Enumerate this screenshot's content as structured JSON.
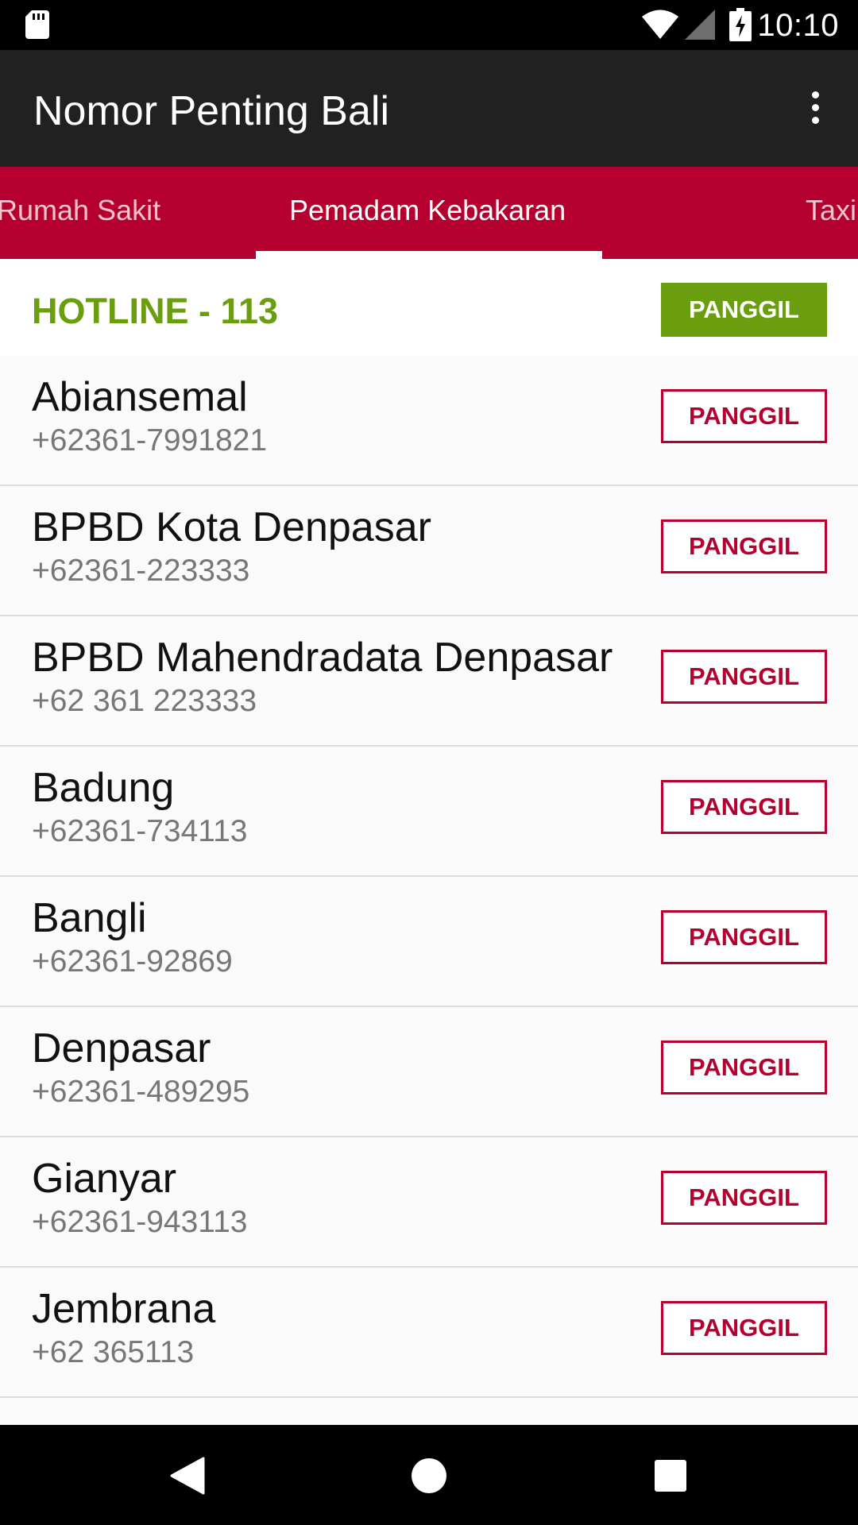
{
  "status_bar": {
    "time": "10:10",
    "icons": [
      "sd-card-icon",
      "wifi-icon",
      "signal-icon",
      "battery-charging-icon"
    ]
  },
  "app_bar": {
    "title": "Nomor Penting Bali",
    "menu_icon": "more-vert-icon"
  },
  "tabs": [
    {
      "label": "Rumah Sakit",
      "active": false
    },
    {
      "label": "Pemadam Kebakaran",
      "active": true
    },
    {
      "label": "Taxi",
      "active": false
    }
  ],
  "hotline": {
    "label": "HOTLINE - 113",
    "button_label": "PANGGIL"
  },
  "contacts": [
    {
      "name": "Abiansemal",
      "phone": "+62361-7991821",
      "button_label": "PANGGIL"
    },
    {
      "name": "BPBD Kota Denpasar",
      "phone": "+62361-223333",
      "button_label": "PANGGIL"
    },
    {
      "name": "BPBD Mahendradata Denpasar",
      "phone": "+62 361 223333",
      "button_label": "PANGGIL"
    },
    {
      "name": "Badung",
      "phone": "+62361-734113",
      "button_label": "PANGGIL"
    },
    {
      "name": "Bangli",
      "phone": "+62361-92869",
      "button_label": "PANGGIL"
    },
    {
      "name": "Denpasar",
      "phone": "+62361-489295",
      "button_label": "PANGGIL"
    },
    {
      "name": "Gianyar",
      "phone": "+62361-943113",
      "button_label": "PANGGIL"
    },
    {
      "name": "Jembrana",
      "phone": "+62 365113",
      "button_label": "PANGGIL"
    }
  ],
  "nav_bar": {
    "icons": [
      "back-icon",
      "home-icon",
      "recents-icon"
    ]
  },
  "colors": {
    "accent": "#b5002f",
    "hotline_green": "#6a9e0e",
    "app_bar": "#212121"
  }
}
